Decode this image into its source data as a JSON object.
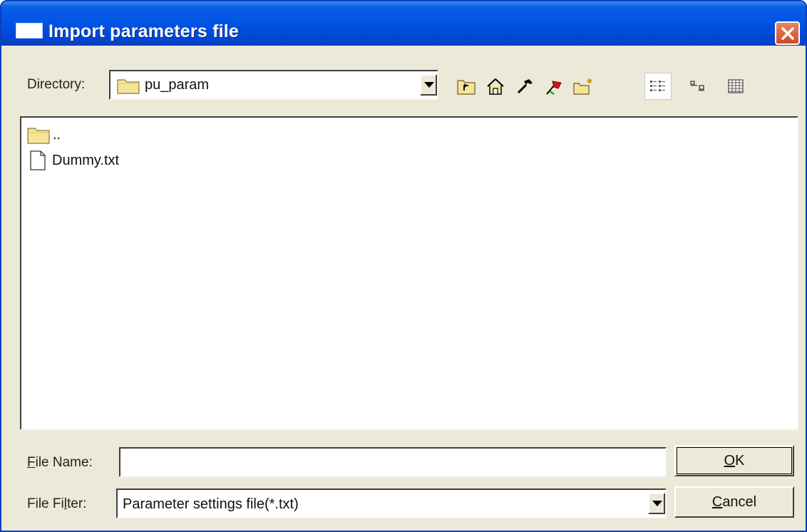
{
  "window": {
    "title": "Import parameters file"
  },
  "directory": {
    "label_mnemonic": "",
    "label": "Directory:",
    "value": "pu_param"
  },
  "toolbar": {
    "buttons": [
      {
        "icon": "up-folder-icon"
      },
      {
        "icon": "home-icon"
      },
      {
        "icon": "hammer-icon"
      },
      {
        "icon": "flag-bookmark-icon"
      },
      {
        "icon": "new-folder-icon"
      },
      {
        "icon": "list-view-icon",
        "pressed": true
      },
      {
        "icon": "details-view-icon"
      },
      {
        "icon": "table-view-icon"
      }
    ]
  },
  "files": [
    {
      "name": "..",
      "type": "folder"
    },
    {
      "name": "Dummy.txt",
      "type": "file"
    }
  ],
  "file_name": {
    "label_mnemonic": "F",
    "label_rest": "ile Name:",
    "value": "",
    "placeholder": ""
  },
  "file_filter": {
    "label_start": "File Fi",
    "label_mnemonic": "l",
    "label_end": "ter:",
    "value": "Parameter settings file(*.txt)"
  },
  "buttons": {
    "ok_mnemonic": "O",
    "ok_rest": "K",
    "cancel_mnemonic": "C",
    "cancel_rest": "ancel"
  },
  "colors": {
    "titlebar": "#0055e5",
    "window_bg": "#ece9d8",
    "close_button": "#d04a22",
    "folder": "#f5e49a"
  }
}
